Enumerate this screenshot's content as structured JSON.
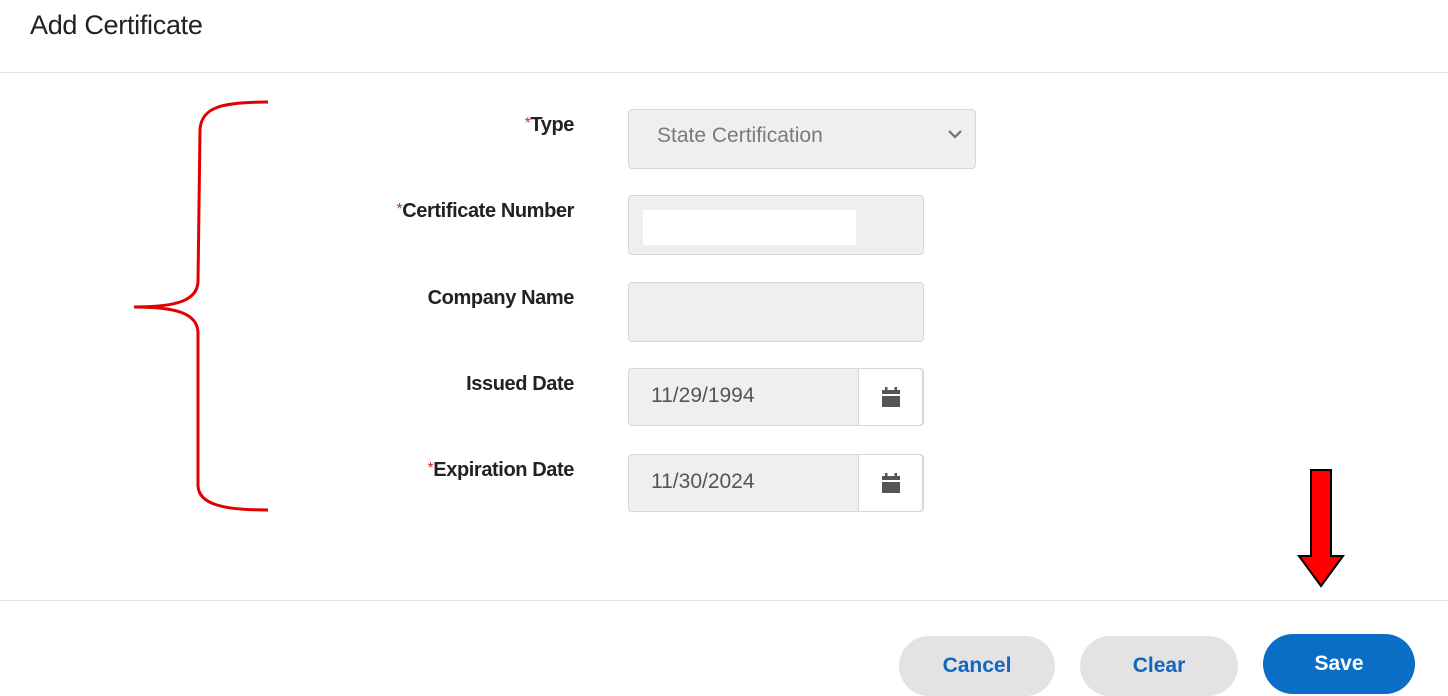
{
  "dialog": {
    "title": "Add Certificate"
  },
  "form": {
    "required_marker": "*",
    "type": {
      "label": "Type",
      "value": "State Certification",
      "required": true
    },
    "certificate_number": {
      "label": "Certificate Number",
      "value": "",
      "required": true
    },
    "company_name": {
      "label": "Company Name",
      "value": "",
      "required": false
    },
    "issued_date": {
      "label": "Issued Date",
      "value": "11/29/1994",
      "required": false
    },
    "expiration_date": {
      "label": "Expiration Date",
      "value": "11/30/2024",
      "required": true
    }
  },
  "footer": {
    "cancel_label": "Cancel",
    "clear_label": "Clear",
    "save_label": "Save"
  },
  "icons": {
    "calendar": "calendar-icon",
    "chevron": "chevron-down-icon",
    "arrow": "arrow-down-icon",
    "bracket": "curly-brace"
  },
  "colors": {
    "required": "#e0281e",
    "primary": "#0b6ec6",
    "link": "#1565c0",
    "annotation": "#e00000"
  }
}
